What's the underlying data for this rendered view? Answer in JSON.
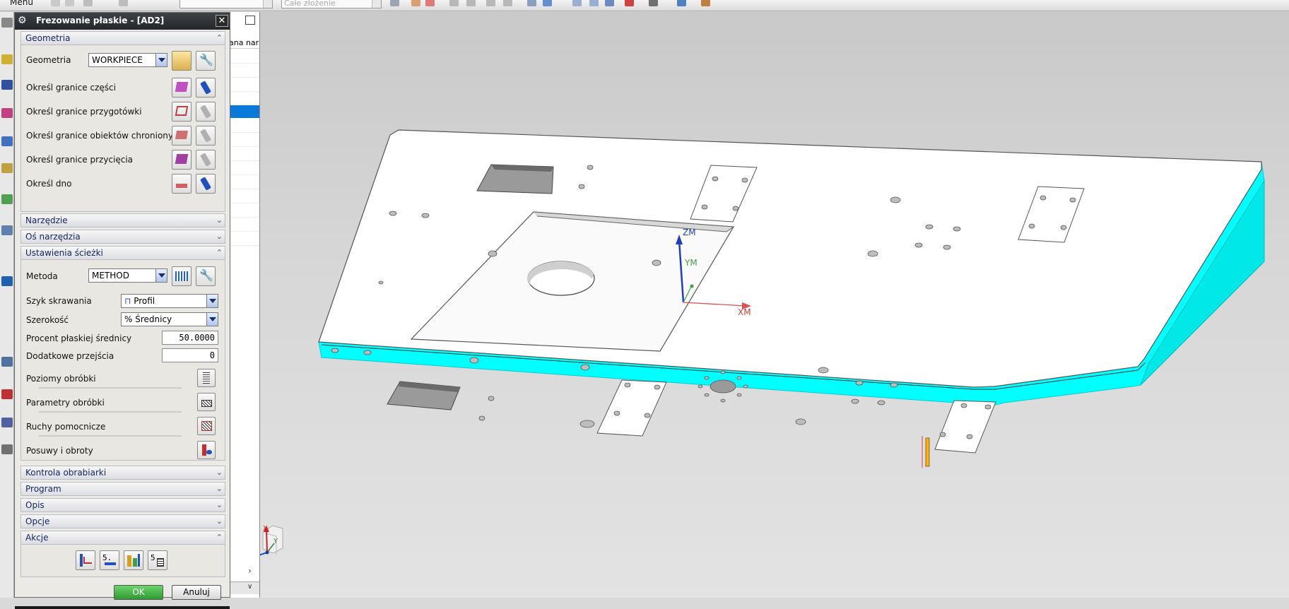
{
  "toolbar": {
    "menu_label": "Menu",
    "selection_filter_placeholder": "",
    "assembly_scope": "Całe złożenie"
  },
  "dialog": {
    "title": "Frezowanie płaskie - [AD2]",
    "sections": {
      "geometry": {
        "label": "Geometria",
        "expanded": true,
        "geometry_label": "Geometria",
        "geometry_value": "WORKPIECE",
        "rows": [
          {
            "label": "Określ granice części",
            "active": true
          },
          {
            "label": "Określ granice przygotówki",
            "active": false
          },
          {
            "label": "Określ granice obiektów chronionych",
            "active": false
          },
          {
            "label": "Określ granice przycięcia",
            "active": false
          },
          {
            "label": "Określ dno",
            "active": true
          }
        ]
      },
      "tool": {
        "label": "Narzędzie",
        "expanded": false
      },
      "tool_axis": {
        "label": "Oś narzędzia",
        "expanded": false
      },
      "path_settings": {
        "label": "Ustawienia ścieżki",
        "expanded": true,
        "method_label": "Metoda",
        "method_value": "METHOD",
        "cut_pattern_label": "Szyk skrawania",
        "cut_pattern_value": "Profil",
        "width_label": "Szerokość",
        "width_value": "% Średnicy",
        "flat_diameter_label": "Procent płaskiej średnicy",
        "flat_diameter_value": "50.0000",
        "extra_passes_label": "Dodatkowe przejścia",
        "extra_passes_value": "0",
        "cut_levels_label": "Poziomy obróbki",
        "cutting_params_label": "Parametry obróbki",
        "non_cutting_moves_label": "Ruchy pomocnicze",
        "feeds_speeds_label": "Posuwy i obroty"
      },
      "machine_control": {
        "label": "Kontrola obrabiarki",
        "expanded": false
      },
      "program": {
        "label": "Program",
        "expanded": false
      },
      "description": {
        "label": "Opis",
        "expanded": false
      },
      "options": {
        "label": "Opcje",
        "expanded": false
      },
      "actions": {
        "label": "Akcje",
        "expanded": true
      }
    },
    "ok_label": "OK",
    "cancel_label": "Anuluj"
  },
  "navigator": {
    "column_header": "ana nar",
    "selected_row_index": 4
  },
  "viewport": {
    "wcs_labels": {
      "z": "ZM",
      "y": "YM",
      "x": "XM"
    },
    "triad_labels": {
      "x": "X",
      "y": "Y",
      "z": "Z"
    },
    "part_side_color": "#00ffff",
    "part_top_color": "#ffffff"
  }
}
